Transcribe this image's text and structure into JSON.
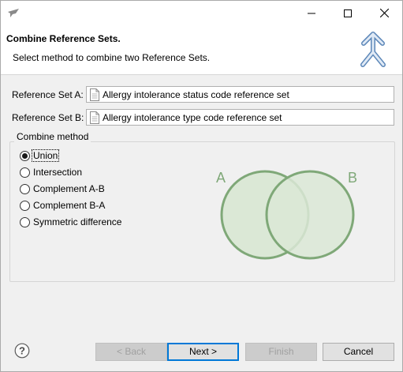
{
  "window": {
    "controls": [
      "minimize",
      "maximize",
      "close"
    ]
  },
  "header": {
    "title": "Combine Reference Sets.",
    "description": "Select method to combine two Reference Sets."
  },
  "fields": {
    "set_a": {
      "label": "Reference Set A:",
      "value": "Allergy intolerance status code reference set"
    },
    "set_b": {
      "label": "Reference Set B:",
      "value": "Allergy intolerance type code reference set"
    }
  },
  "combine": {
    "group_label": "Combine method",
    "selected": "Union",
    "options": [
      {
        "label": "Union",
        "checked": true
      },
      {
        "label": "Intersection",
        "checked": false
      },
      {
        "label": "Complement A-B",
        "checked": false
      },
      {
        "label": "Complement B-A",
        "checked": false
      },
      {
        "label": "Symmetric difference",
        "checked": false
      }
    ]
  },
  "venn": {
    "label_a": "A",
    "label_b": "B",
    "fill_color": "#dbe8d6",
    "stroke_color": "#7fa878",
    "label_color": "#7fa878"
  },
  "footer": {
    "help_icon": "question-mark-icon",
    "back": {
      "label": "< Back",
      "enabled": false
    },
    "next": {
      "label": "Next >",
      "enabled": true
    },
    "finish": {
      "label": "Finish",
      "enabled": false
    },
    "cancel": {
      "label": "Cancel",
      "enabled": true
    }
  }
}
